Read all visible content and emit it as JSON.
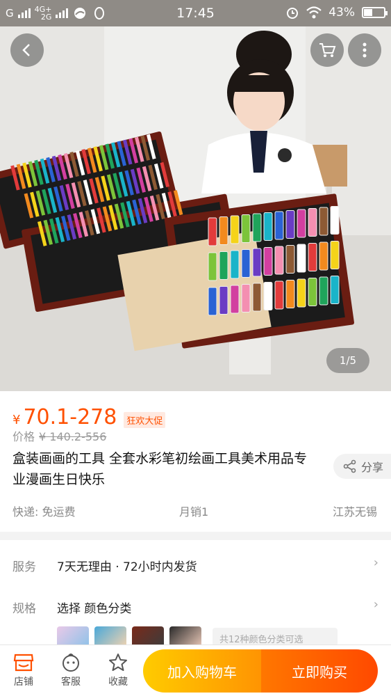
{
  "status_bar": {
    "carrier_left": "G",
    "network_top": "4G+",
    "network_bottom": "2G",
    "time": "17:45",
    "battery": "43%",
    "battery_level": 0.43
  },
  "hero": {
    "pager": "1/5"
  },
  "product": {
    "price_symbol": "¥",
    "price": "70.1-278",
    "promo_tag": "狂欢大促",
    "orig_label": "价格",
    "orig_price": "¥ 140.2-556",
    "title": "盒装画画的工具 全套水彩笔初绘画工具美术用品专业漫画生日快乐",
    "share": "分享",
    "shipping": "快递: 免运费",
    "monthly_sales": "月销1",
    "location": "江苏无锡"
  },
  "service": {
    "label": "服务",
    "value": "7天无理由 · 72小时内发货"
  },
  "spec": {
    "label": "规格",
    "value": "选择 颜色分类",
    "more": "共12种颜色分类可选"
  },
  "bottom_bar": {
    "store": "店铺",
    "service": "客服",
    "favorite": "收藏",
    "add_cart": "加入购物车",
    "buy_now": "立即购买"
  },
  "colors": {
    "accent": "#ff5000",
    "cart_button": "#ffa200",
    "buy_button": "#ff5a00"
  }
}
